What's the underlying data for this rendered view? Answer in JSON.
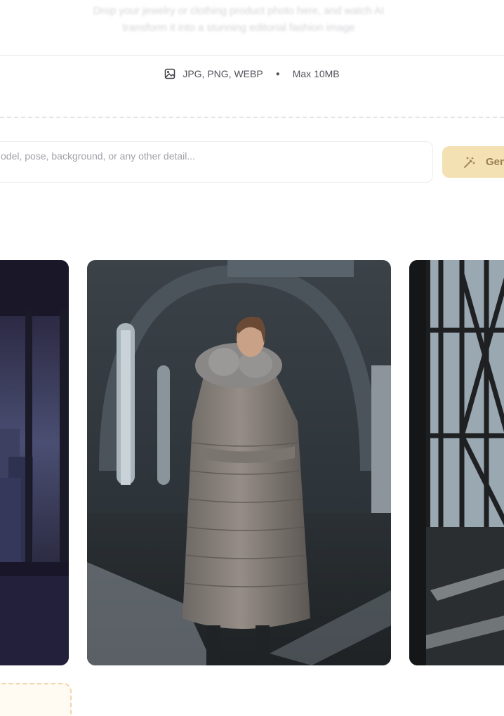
{
  "upload": {
    "description": "Drop your jewelry or clothing product photo here, and watch AI transform it into a stunning editorial fashion image",
    "formats": "JPG, PNG, WEBP",
    "max_size": "Max 10MB",
    "icon": "image-icon"
  },
  "prompt": {
    "placeholder": "odel, pose, background, or any other detail...",
    "value": ""
  },
  "generate": {
    "label": "Gen",
    "icon": "magic-wand-icon",
    "bg_color": "#f3e0b3",
    "text_color": "#9a7f4e"
  },
  "gallery": {
    "images": [
      {
        "name": "night-city-window-scene"
      },
      {
        "name": "model-long-puffer-coat-with-fur-hood"
      },
      {
        "name": "industrial-window-sunlight-scene"
      }
    ]
  }
}
